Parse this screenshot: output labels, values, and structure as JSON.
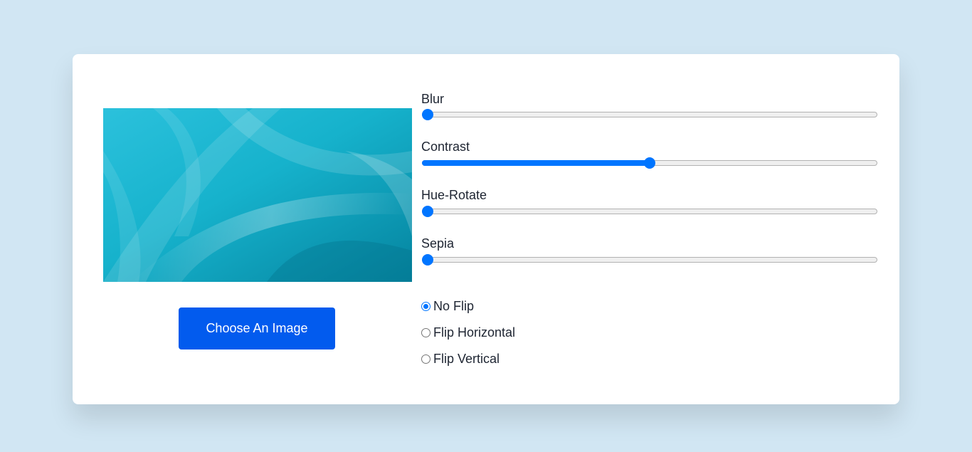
{
  "colors": {
    "page_background": "#d1e6f3",
    "card_background": "#ffffff",
    "button_background": "#025bee",
    "accent": "#0075ff",
    "text": "#1e2532"
  },
  "upload": {
    "button_label": "Choose An Image"
  },
  "filters": [
    {
      "label": "Blur",
      "value_fraction": 0.0
    },
    {
      "label": "Contrast",
      "value_fraction": 0.5
    },
    {
      "label": "Hue-Rotate",
      "value_fraction": 0.0
    },
    {
      "label": "Sepia",
      "value_fraction": 0.0
    }
  ],
  "flip_options": [
    {
      "label": "No Flip",
      "checked": true
    },
    {
      "label": "Flip Horizontal",
      "checked": false
    },
    {
      "label": "Flip Vertical",
      "checked": false
    }
  ]
}
